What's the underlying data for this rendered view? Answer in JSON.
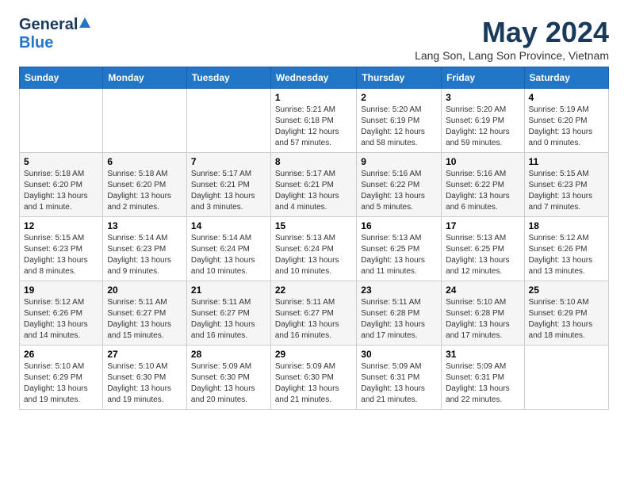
{
  "header": {
    "logo_general": "General",
    "logo_blue": "Blue",
    "title": "May 2024",
    "subtitle": "Lang Son, Lang Son Province, Vietnam"
  },
  "columns": [
    "Sunday",
    "Monday",
    "Tuesday",
    "Wednesday",
    "Thursday",
    "Friday",
    "Saturday"
  ],
  "weeks": [
    [
      {
        "day": "",
        "info": ""
      },
      {
        "day": "",
        "info": ""
      },
      {
        "day": "",
        "info": ""
      },
      {
        "day": "1",
        "info": "Sunrise: 5:21 AM\nSunset: 6:18 PM\nDaylight: 12 hours\nand 57 minutes."
      },
      {
        "day": "2",
        "info": "Sunrise: 5:20 AM\nSunset: 6:19 PM\nDaylight: 12 hours\nand 58 minutes."
      },
      {
        "day": "3",
        "info": "Sunrise: 5:20 AM\nSunset: 6:19 PM\nDaylight: 12 hours\nand 59 minutes."
      },
      {
        "day": "4",
        "info": "Sunrise: 5:19 AM\nSunset: 6:20 PM\nDaylight: 13 hours\nand 0 minutes."
      }
    ],
    [
      {
        "day": "5",
        "info": "Sunrise: 5:18 AM\nSunset: 6:20 PM\nDaylight: 13 hours\nand 1 minute."
      },
      {
        "day": "6",
        "info": "Sunrise: 5:18 AM\nSunset: 6:20 PM\nDaylight: 13 hours\nand 2 minutes."
      },
      {
        "day": "7",
        "info": "Sunrise: 5:17 AM\nSunset: 6:21 PM\nDaylight: 13 hours\nand 3 minutes."
      },
      {
        "day": "8",
        "info": "Sunrise: 5:17 AM\nSunset: 6:21 PM\nDaylight: 13 hours\nand 4 minutes."
      },
      {
        "day": "9",
        "info": "Sunrise: 5:16 AM\nSunset: 6:22 PM\nDaylight: 13 hours\nand 5 minutes."
      },
      {
        "day": "10",
        "info": "Sunrise: 5:16 AM\nSunset: 6:22 PM\nDaylight: 13 hours\nand 6 minutes."
      },
      {
        "day": "11",
        "info": "Sunrise: 5:15 AM\nSunset: 6:23 PM\nDaylight: 13 hours\nand 7 minutes."
      }
    ],
    [
      {
        "day": "12",
        "info": "Sunrise: 5:15 AM\nSunset: 6:23 PM\nDaylight: 13 hours\nand 8 minutes."
      },
      {
        "day": "13",
        "info": "Sunrise: 5:14 AM\nSunset: 6:23 PM\nDaylight: 13 hours\nand 9 minutes."
      },
      {
        "day": "14",
        "info": "Sunrise: 5:14 AM\nSunset: 6:24 PM\nDaylight: 13 hours\nand 10 minutes."
      },
      {
        "day": "15",
        "info": "Sunrise: 5:13 AM\nSunset: 6:24 PM\nDaylight: 13 hours\nand 10 minutes."
      },
      {
        "day": "16",
        "info": "Sunrise: 5:13 AM\nSunset: 6:25 PM\nDaylight: 13 hours\nand 11 minutes."
      },
      {
        "day": "17",
        "info": "Sunrise: 5:13 AM\nSunset: 6:25 PM\nDaylight: 13 hours\nand 12 minutes."
      },
      {
        "day": "18",
        "info": "Sunrise: 5:12 AM\nSunset: 6:26 PM\nDaylight: 13 hours\nand 13 minutes."
      }
    ],
    [
      {
        "day": "19",
        "info": "Sunrise: 5:12 AM\nSunset: 6:26 PM\nDaylight: 13 hours\nand 14 minutes."
      },
      {
        "day": "20",
        "info": "Sunrise: 5:11 AM\nSunset: 6:27 PM\nDaylight: 13 hours\nand 15 minutes."
      },
      {
        "day": "21",
        "info": "Sunrise: 5:11 AM\nSunset: 6:27 PM\nDaylight: 13 hours\nand 16 minutes."
      },
      {
        "day": "22",
        "info": "Sunrise: 5:11 AM\nSunset: 6:27 PM\nDaylight: 13 hours\nand 16 minutes."
      },
      {
        "day": "23",
        "info": "Sunrise: 5:11 AM\nSunset: 6:28 PM\nDaylight: 13 hours\nand 17 minutes."
      },
      {
        "day": "24",
        "info": "Sunrise: 5:10 AM\nSunset: 6:28 PM\nDaylight: 13 hours\nand 17 minutes."
      },
      {
        "day": "25",
        "info": "Sunrise: 5:10 AM\nSunset: 6:29 PM\nDaylight: 13 hours\nand 18 minutes."
      }
    ],
    [
      {
        "day": "26",
        "info": "Sunrise: 5:10 AM\nSunset: 6:29 PM\nDaylight: 13 hours\nand 19 minutes."
      },
      {
        "day": "27",
        "info": "Sunrise: 5:10 AM\nSunset: 6:30 PM\nDaylight: 13 hours\nand 19 minutes."
      },
      {
        "day": "28",
        "info": "Sunrise: 5:09 AM\nSunset: 6:30 PM\nDaylight: 13 hours\nand 20 minutes."
      },
      {
        "day": "29",
        "info": "Sunrise: 5:09 AM\nSunset: 6:30 PM\nDaylight: 13 hours\nand 21 minutes."
      },
      {
        "day": "30",
        "info": "Sunrise: 5:09 AM\nSunset: 6:31 PM\nDaylight: 13 hours\nand 21 minutes."
      },
      {
        "day": "31",
        "info": "Sunrise: 5:09 AM\nSunset: 6:31 PM\nDaylight: 13 hours\nand 22 minutes."
      },
      {
        "day": "",
        "info": ""
      }
    ]
  ]
}
